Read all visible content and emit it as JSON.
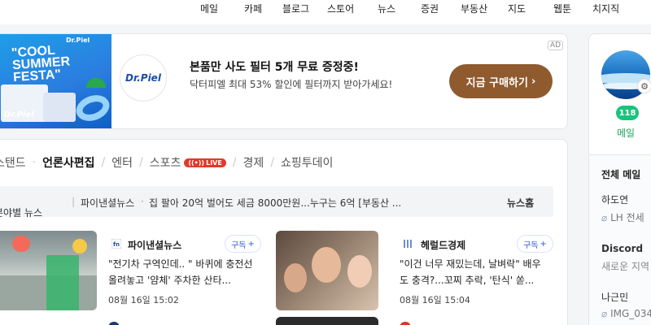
{
  "nav": {
    "items": [
      "메일",
      "카페",
      "블로그",
      "스토어",
      "뉴스",
      "증권",
      "부동산",
      "지도",
      "웹툰",
      "치지직"
    ]
  },
  "ad": {
    "banner_title": "\"COOL SUMMER FESTA\"",
    "banner_brand": "Dr.Piel",
    "logo_text": "Dr.Piel",
    "title": "본품만 사도 필터 5개 무료 증정중!",
    "description": "닥터피엘 최대 53% 할인에 필터까지 받아가세요!",
    "button_label": "지금 구매하기",
    "ad_tag": "AD"
  },
  "news": {
    "tabs": [
      "스탠드",
      "언론사편집",
      "엔터",
      "스포츠",
      "경제",
      "쇼핑투데이"
    ],
    "active_tab": "언론사편집",
    "live_badge": "LIVE",
    "category_label": "분야별 뉴스",
    "ticker_source": "파이낸셜뉴스",
    "ticker_text": "집 팔아 20억 벌어도 세금 8000만원...누구는 6억 [부동산 ...",
    "home_label": "뉴스홈",
    "items": [
      {
        "press": "파이낸셜뉴스",
        "subscribe_label": "구독",
        "headline": "\"전기차 구역인데.. \" 바퀴에 충전선 올려놓고 '얌체' 주차한 산타...",
        "date": "08월 16일 15:02"
      },
      {
        "press": "헤럴드경제",
        "subscribe_label": "구독",
        "headline": "\"이건 너무 재밌는데, 날벼락\" 배우도 충격?...꼬찌 추락, '탄식' 쏟...",
        "date": "08월 16일 15:04"
      }
    ]
  },
  "side": {
    "mail_count": "118",
    "mail_label": "메일",
    "mailbox_title": "전체 메일",
    "entries": [
      {
        "sender": "하도연",
        "preview": "LH 전세"
      },
      {
        "sender": "Discord",
        "preview": "새로운 지역"
      },
      {
        "sender": "나근민",
        "preview": "IMG_034"
      }
    ]
  },
  "colors": {
    "accent_green": "#19c37d",
    "live_red": "#e03a2b",
    "ad_button": "#8e5a2e",
    "subscribe_blue": "#2d5bd6"
  }
}
